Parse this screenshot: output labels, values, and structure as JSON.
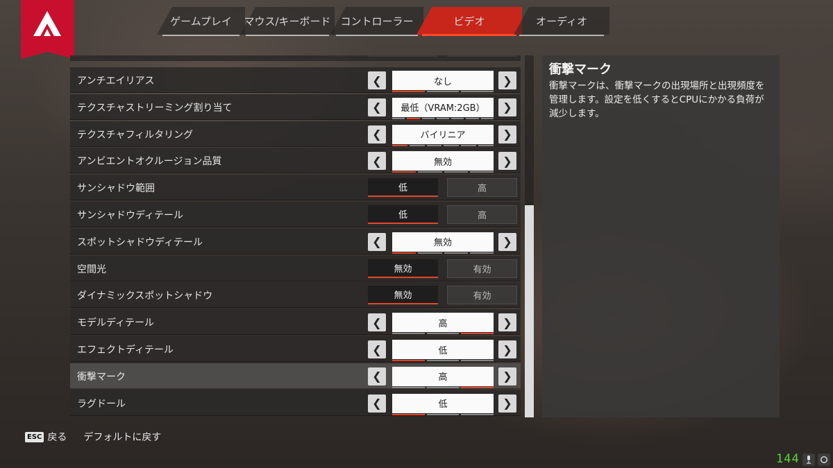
{
  "nav": {
    "tabs": [
      {
        "label": "ゲームプレイ",
        "active": false
      },
      {
        "label": "マウス/キーボード",
        "active": false
      },
      {
        "label": "コントローラー",
        "active": false
      },
      {
        "label": "ビデオ",
        "active": true
      },
      {
        "label": "オーディオ",
        "active": false
      }
    ],
    "logo": "apex-logo-icon"
  },
  "settings": [
    {
      "label": "アンチエイリアス",
      "type": "select",
      "value": "なし",
      "levels": 3,
      "level": 1
    },
    {
      "label": "テクスチャストリーミング割り当て",
      "type": "select",
      "value": "最低（VRAM:2GB）",
      "levels": 7,
      "level": 2
    },
    {
      "label": "テクスチャフィルタリング",
      "type": "select",
      "value": "バイリニア",
      "levels": 6,
      "level": 1
    },
    {
      "label": "アンビエントオクルージョン品質",
      "type": "select",
      "value": "無効",
      "levels": 4,
      "level": 1
    },
    {
      "label": "サンシャドウ範囲",
      "type": "toggle",
      "options": [
        "低",
        "高"
      ],
      "selected": 0
    },
    {
      "label": "サンシャドウディテール",
      "type": "toggle",
      "options": [
        "低",
        "高"
      ],
      "selected": 0
    },
    {
      "label": "スポットシャドウディテール",
      "type": "select",
      "value": "無効",
      "levels": 4,
      "level": 1
    },
    {
      "label": "空間光",
      "type": "toggle",
      "options": [
        "無効",
        "有効"
      ],
      "selected": 0
    },
    {
      "label": "ダイナミックスポットシャドウ",
      "type": "toggle",
      "options": [
        "無効",
        "有効"
      ],
      "selected": 0
    },
    {
      "label": "モデルディテール",
      "type": "select",
      "value": "高",
      "levels": 3,
      "level": 3
    },
    {
      "label": "エフェクトディテール",
      "type": "select",
      "value": "低",
      "levels": 3,
      "level": 1
    },
    {
      "label": "衝撃マーク",
      "type": "select",
      "value": "高",
      "levels": 3,
      "level": 3,
      "highlighted": true
    },
    {
      "label": "ラグドール",
      "type": "select",
      "value": "低",
      "levels": 3,
      "level": 1
    }
  ],
  "description": {
    "title": "衝撃マーク",
    "text": "衝撃マークは、衝撃マークの出現場所と出現頻度を管理します。設定を低くするとCPUにかかる負荷が減少します。"
  },
  "footer": {
    "esc_key": "ESC",
    "back_label": "戻る",
    "default_label": "デフォルトに戻す"
  },
  "overlay": {
    "fps": "144",
    "icons": [
      "microphone-icon",
      "refresh-icon"
    ]
  },
  "colors": {
    "accent": "#e8452b",
    "brand_red": "#c8102e"
  }
}
